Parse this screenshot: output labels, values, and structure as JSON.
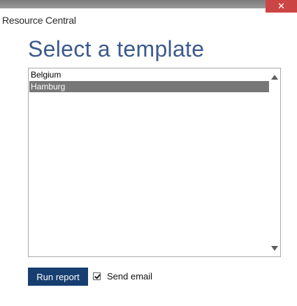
{
  "window": {
    "title": "Resource Central",
    "close_glyph": "✕"
  },
  "main": {
    "heading": "Select a template"
  },
  "template_list": {
    "items": [
      {
        "label": "Belgium",
        "selected": false
      },
      {
        "label": "Hamburg",
        "selected": true
      }
    ],
    "scroll_up_icon": "triangle-up",
    "scroll_down_icon": "triangle-down"
  },
  "actions": {
    "run_report_label": "Run report",
    "send_email_label": "Send email",
    "send_email_checked": true
  },
  "colors": {
    "heading": "#3c5a8c",
    "run_button": "#173e70",
    "selection": "#777777",
    "close_button": "#cc4545"
  }
}
